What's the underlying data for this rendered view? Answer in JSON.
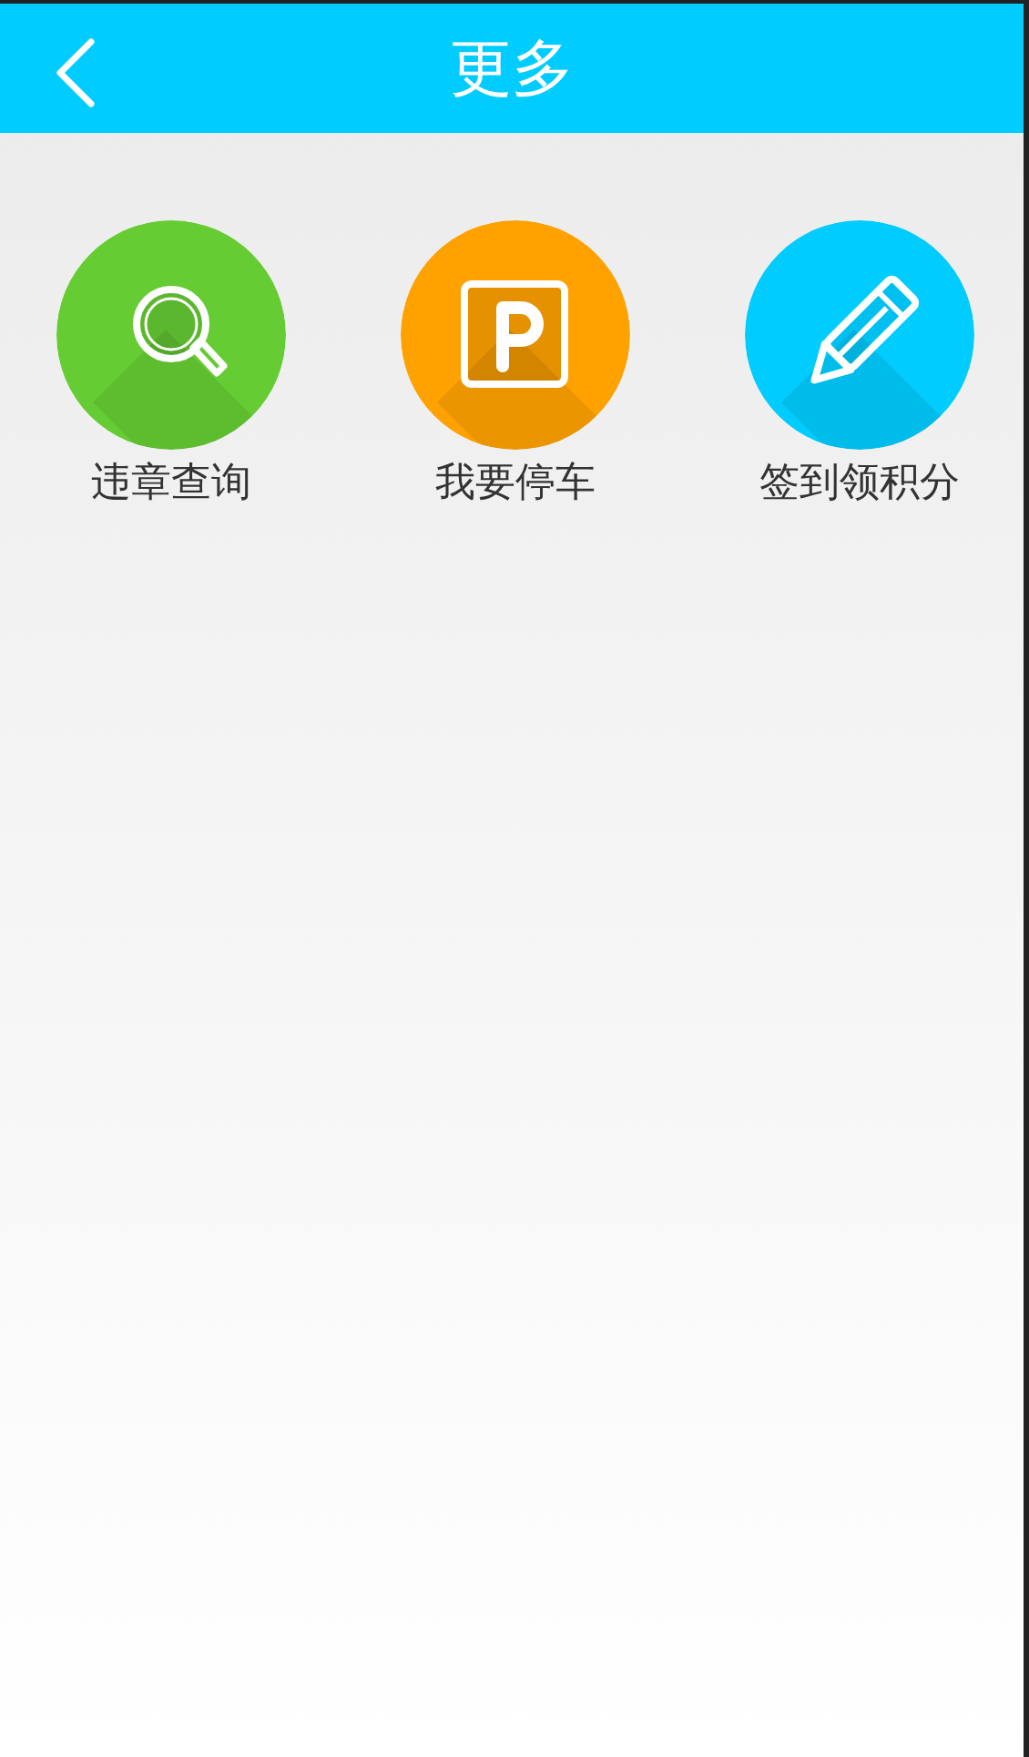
{
  "header": {
    "title": "更多"
  },
  "items": [
    {
      "label": "违章查询",
      "kind": "search",
      "color": "#66cc33"
    },
    {
      "label": "我要停车",
      "kind": "parking",
      "color": "#ffa200"
    },
    {
      "label": "签到领积分",
      "kind": "pencil",
      "color": "#00ccff"
    }
  ]
}
